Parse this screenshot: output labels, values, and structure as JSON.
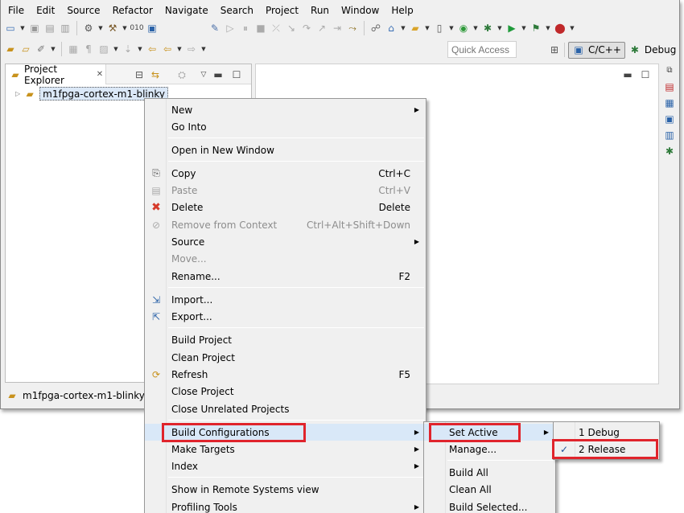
{
  "menubar": [
    "File",
    "Edit",
    "Source",
    "Refactor",
    "Navigate",
    "Search",
    "Project",
    "Run",
    "Window",
    "Help"
  ],
  "quick_access": {
    "placeholder": "Quick Access"
  },
  "perspectives": {
    "cpp": "C/C++",
    "debug": "Debug"
  },
  "project_explorer": {
    "title": "Project Explorer",
    "project": "m1fpga-cortex-m1-blinky"
  },
  "status_bar": {
    "text": "m1fpga-cortex-m1-blinky"
  },
  "context_menu": {
    "new": "New",
    "go_into": "Go Into",
    "open_new_window": "Open in New Window",
    "copy": "Copy",
    "copy_sc": "Ctrl+C",
    "paste": "Paste",
    "paste_sc": "Ctrl+V",
    "delete": "Delete",
    "delete_sc": "Delete",
    "remove": "Remove from Context",
    "remove_sc": "Ctrl+Alt+Shift+Down",
    "source": "Source",
    "move": "Move...",
    "rename": "Rename...",
    "rename_sc": "F2",
    "import": "Import...",
    "export": "Export...",
    "build_project": "Build Project",
    "clean_project": "Clean Project",
    "refresh": "Refresh",
    "refresh_sc": "F5",
    "close_project": "Close Project",
    "close_unrelated": "Close Unrelated Projects",
    "build_configurations": "Build Configurations",
    "make_targets": "Make Targets",
    "index": "Index",
    "remote_systems": "Show in Remote Systems view",
    "profiling": "Profiling Tools"
  },
  "build_config_menu": {
    "set_active": "Set Active",
    "manage": "Manage...",
    "build_all": "Build All",
    "clean_all": "Clean All",
    "build_selected": "Build Selected..."
  },
  "set_active_menu": {
    "debug": "1 Debug",
    "release": "2 Release",
    "checked": "✓"
  },
  "colors": {
    "highlight_box": "#e0242c",
    "selection": "#d9e8f8",
    "menu_bg": "#f0f0f0"
  }
}
